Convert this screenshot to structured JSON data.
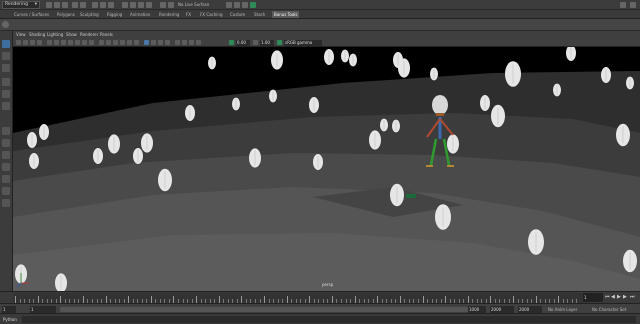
{
  "topbar": {
    "mode": "Rendering",
    "live_surface": "No Live Surface"
  },
  "shelf_tabs": [
    {
      "label": "Curves / Surfaces",
      "active": false
    },
    {
      "label": "Polygons",
      "active": false
    },
    {
      "label": "Sculpting",
      "active": false
    },
    {
      "label": "Rigging",
      "active": false
    },
    {
      "label": "Animation",
      "active": false
    },
    {
      "label": "Rendering",
      "active": false
    },
    {
      "label": "FX",
      "active": false
    },
    {
      "label": "FX Caching",
      "active": false
    },
    {
      "label": "Custom",
      "active": false
    },
    {
      "label": "Stash",
      "active": false
    },
    {
      "label": "Bonus Tools",
      "active": true
    }
  ],
  "panel_menu": [
    "View",
    "Shading",
    "Lighting",
    "Show",
    "Renderer",
    "Panels"
  ],
  "viewport_toolbar": {
    "near_value": "0.00",
    "far_value": "1.00",
    "color_space": "sRGB gamma"
  },
  "viewport": {
    "camera_label": "persp"
  },
  "time_slider": {
    "ticks": [
      "1",
      "5",
      "10",
      "15",
      "20",
      "25",
      "30",
      "35",
      "40",
      "45",
      "50",
      "55",
      "60",
      "65",
      "70",
      "75",
      "80",
      "85",
      "90",
      "95",
      "100",
      "105",
      "110",
      "115",
      "120"
    ],
    "current_frame": "1"
  },
  "range_slider": {
    "start": "1",
    "playback_start": "1",
    "playback_end": "1000",
    "end_a": "2000",
    "end_b": "2000",
    "anim_layer": "No Anim Layer",
    "char_set": "No Character Set"
  },
  "command_line": {
    "label": "Python"
  },
  "colors": {
    "accent_blue": "#3d6ea0",
    "shelf_green": "#2e8b57"
  }
}
